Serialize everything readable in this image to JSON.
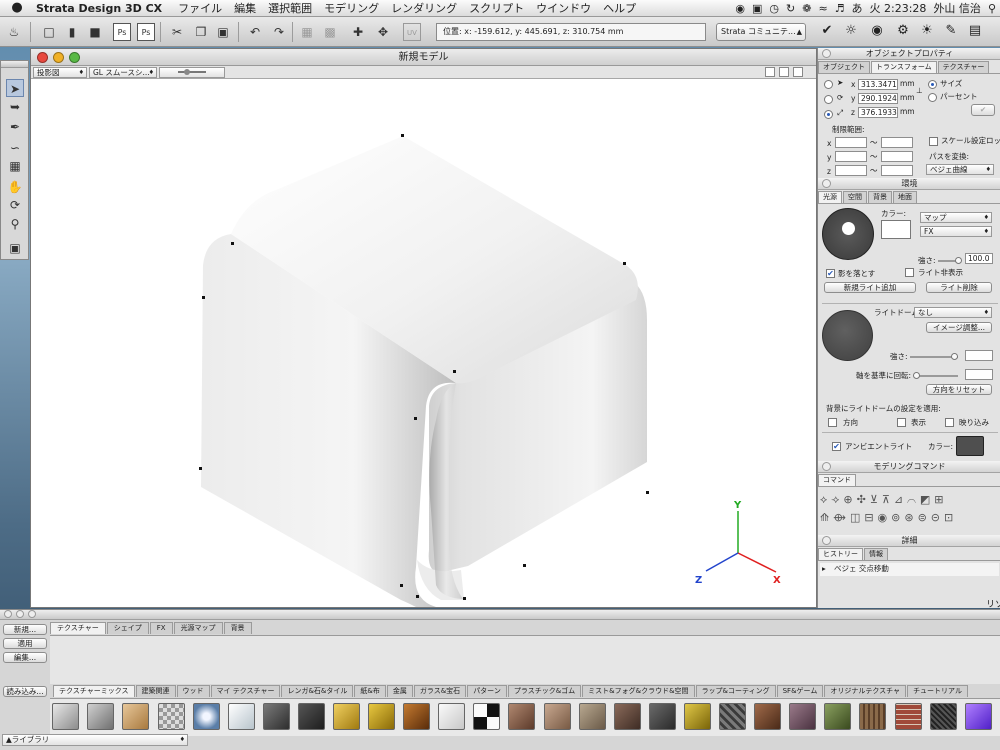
{
  "menubar": {
    "app_name": "Strata Design 3D CX",
    "items": [
      "ファイル",
      "編集",
      "選択範囲",
      "モデリング",
      "レンダリング",
      "スクリプト",
      "ウインドウ",
      "ヘルプ"
    ],
    "clock": "火 2:23:28",
    "user": "外山 信治"
  },
  "toolbar": {
    "coords": "位置: x: -159.612, y: 445.691, z: 310.754 mm",
    "community": "Strata コミュニテ..."
  },
  "model_window": {
    "title": "新規モデル",
    "projection": "投影図",
    "render_mode": "GL スムースシ..."
  },
  "object_properties": {
    "title": "オブジェクトプロパティ",
    "tabs": [
      "オブジェクト",
      "トランスフォーム",
      "テクスチャー"
    ],
    "x_val": "313.3471",
    "y_val": "290.1924",
    "z_val": "376.1933",
    "unit": "mm",
    "size_label": "サイズ",
    "percent_label": "パーセント",
    "limit_label": "制限範囲:",
    "axis_x": "x",
    "axis_y": "y",
    "axis_z": "z",
    "tilde": "～",
    "scale_lock": "スケール設定ロック",
    "path_convert": "パスを変換:",
    "bezier": "ベジェ曲線"
  },
  "environment": {
    "title": "環境",
    "tabs": [
      "光源",
      "空間",
      "背景",
      "地面"
    ],
    "color_label": "カラー:",
    "map": "マップ",
    "fx": "FX",
    "strength": "強さ:",
    "strength_val": "100.0",
    "cast_shadow": "影を落とす",
    "hide_light": "ライト非表示",
    "add_light": "新規ライト追加",
    "delete_light": "ライト削除",
    "light_dome": "ライトドーム:",
    "none": "なし",
    "image_adjust": "イメージ調整...",
    "strength2": "強さ:",
    "rotate_axis": "軸を基準に回転:",
    "reset_dir": "方向をリセット",
    "apply_bg": "背景にライトドームの設定を適用:",
    "direction": "方向",
    "display": "表示",
    "reflect": "映り込み",
    "ambient": "アンビエントライト",
    "color2": "カラー:"
  },
  "modeling_commands": {
    "title": "モデリングコマンド",
    "tab": "コマンド"
  },
  "details": {
    "title": "詳細",
    "tabs": [
      "ヒストリー",
      "情報"
    ],
    "history_item": "ベジェ 交点移動",
    "side_label": "リソ"
  },
  "bottom": {
    "new_btn": "新規...",
    "apply_btn": "適用",
    "edit_btn": "編集...",
    "load_btn": "読み込み...",
    "library": "ライブラリ",
    "top_tabs": [
      "テクスチャー",
      "シェイプ",
      "FX",
      "光源マップ",
      "背景"
    ],
    "cat_tabs": [
      "テクスチャーミックス",
      "建築関連",
      "ウッド",
      "マイ テクスチャー",
      "レンガ&石&タイル",
      "紙&布",
      "金属",
      "ガラス&宝石",
      "パターン",
      "プラスチック&ゴム",
      "ミスト&フォグ&クラウド&空間",
      "ラップ&コーティング",
      "SF&ゲーム",
      "オリジナルテクスチャ",
      "チュートリアル"
    ]
  },
  "axes": {
    "x": "X",
    "y": "Y",
    "z": "Z"
  },
  "colors": {
    "x_axis": "#e02020",
    "y_axis": "#22aa22",
    "z_axis": "#2244cc",
    "selection": "#b8c8de"
  }
}
